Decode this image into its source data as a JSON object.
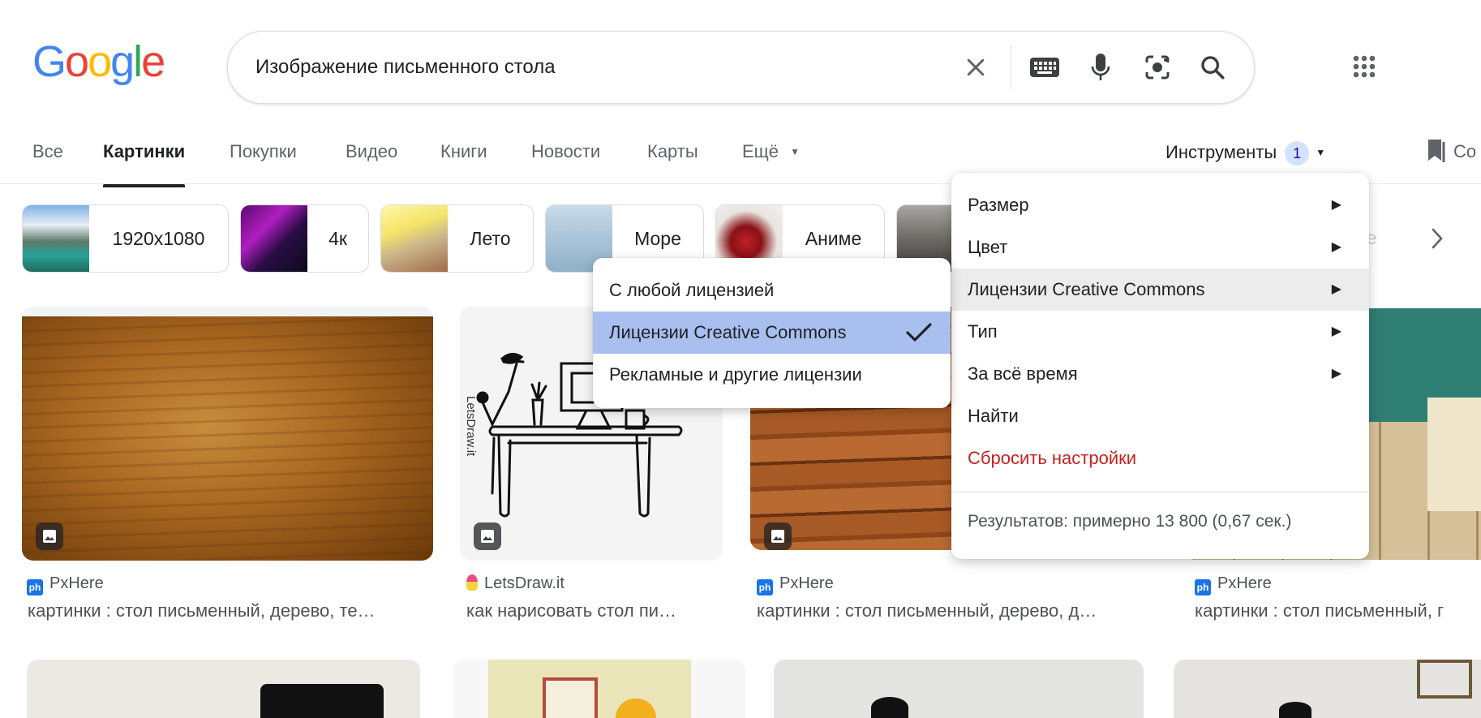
{
  "logo": {
    "letters": [
      "G",
      "o",
      "o",
      "g",
      "l",
      "e"
    ],
    "colors": [
      "#4285F4",
      "#EA4335",
      "#FBBC05",
      "#4285F4",
      "#34A853",
      "#EA4335"
    ]
  },
  "search": {
    "query": "Изображение письменного стола"
  },
  "tabs": [
    {
      "label": "Все"
    },
    {
      "label": "Картинки",
      "active": true
    },
    {
      "label": "Покупки"
    },
    {
      "label": "Видео"
    },
    {
      "label": "Книги"
    },
    {
      "label": "Новости"
    },
    {
      "label": "Карты"
    },
    {
      "label": "Ещё"
    }
  ],
  "tools": {
    "label": "Инструменты",
    "count": "1"
  },
  "saved": {
    "label": "Со"
  },
  "chips": [
    {
      "label": "1920x1080"
    },
    {
      "label": "4к"
    },
    {
      "label": "Лето"
    },
    {
      "label": "Море"
    },
    {
      "label": "Аниме"
    }
  ],
  "chip_overflow_text": "энте",
  "results": [
    {
      "source": "PxHere",
      "title": "картинки : стол письменный, дерево, те…"
    },
    {
      "source": "LetsDraw.it",
      "title": "как нарисовать стол пи…"
    },
    {
      "source": "PxHere",
      "title": "картинки : стол письменный, дерево, д…"
    },
    {
      "source": "PxHere",
      "title": "картинки : стол письменный, г"
    }
  ],
  "watermark": "LetsDraw.it",
  "tools_menu": {
    "items": [
      "Размер",
      "Цвет",
      "Лицензии Creative Commons",
      "Тип",
      "За всё время",
      "Найти"
    ],
    "reset": "Сбросить настройки",
    "stats": "Результатов: примерно 13 800 (0,67 сек.)"
  },
  "license_menu": {
    "items": [
      "С любой лицензией",
      "Лицензии Creative Commons",
      "Рекламные и другие лицензии"
    ],
    "selected_index": 1
  },
  "colors": {
    "accent_blue": "#1a73e8",
    "reset_red": "#c5221f",
    "selected_bg": "#a8bff0"
  }
}
